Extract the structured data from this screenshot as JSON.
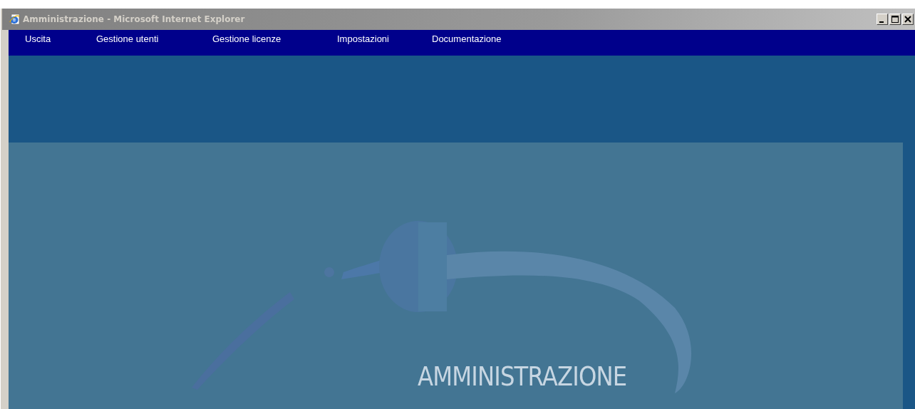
{
  "window": {
    "title": "Amministrazione - Microsoft Internet Explorer"
  },
  "menu": {
    "items": [
      "Uscita",
      "Gestione utenti",
      "Gestione licenze",
      "Impostazioni",
      "Documentazione"
    ]
  },
  "banner": {
    "title": "AMMINISTRAZIONE"
  }
}
